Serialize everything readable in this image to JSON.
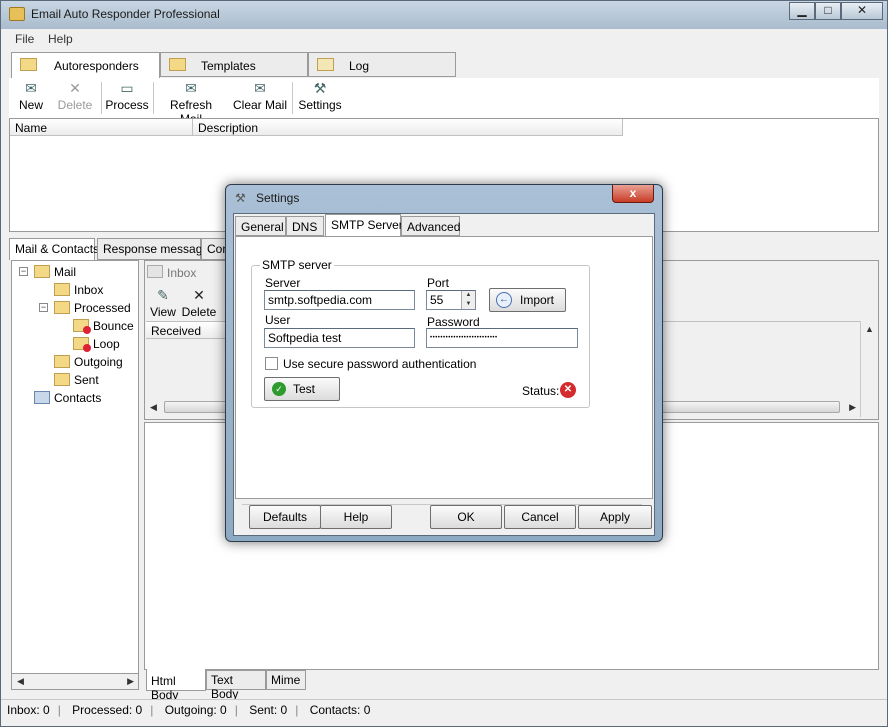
{
  "window": {
    "title": "Email Auto Responder Professional"
  },
  "menu": [
    "File",
    "Help"
  ],
  "top_tabs": [
    "Autoresponders",
    "Templates",
    "Log"
  ],
  "toolbar": {
    "new": "New",
    "delete": "Delete",
    "process": "Process",
    "refresh_mail": "Refresh Mail",
    "clear_mail": "Clear Mail",
    "settings": "Settings"
  },
  "grid": {
    "columns": [
      "Name",
      "Description"
    ]
  },
  "mid_tabs": [
    "Mail & Contacts",
    "Response message",
    "Con"
  ],
  "tree": {
    "mail": "Mail",
    "inbox": "Inbox",
    "processed": "Processed",
    "bounce": "Bounce",
    "loop": "Loop",
    "outgoing": "Outgoing",
    "sent": "Sent",
    "contacts": "Contacts"
  },
  "inbox_pane": {
    "title": "Inbox",
    "view": "View",
    "delete": "Delete",
    "received_col": "Received"
  },
  "body_tabs": [
    "Html Body",
    "Text Body",
    "Mime"
  ],
  "status": {
    "inbox": "Inbox: 0",
    "processed": "Processed: 0",
    "outgoing": "Outgoing: 0",
    "sent": "Sent: 0",
    "contacts": "Contacts: 0"
  },
  "dialog": {
    "title": "Settings",
    "close": "x",
    "tabs": [
      "General",
      "DNS",
      "SMTP Server",
      "Advanced"
    ],
    "group_label": "SMTP server",
    "server_label": "Server",
    "server_value": "smtp.softpedia.com",
    "port_label": "Port",
    "port_value": "55",
    "import_button": "Import",
    "user_label": "User",
    "user_value": "Softpedia test",
    "password_label": "Password",
    "password_value": "••••••••••••••••••••••••••",
    "secure_auth_label": "Use secure password authentication",
    "test_button": "Test",
    "status_label": "Status:",
    "buttons": {
      "defaults": "Defaults",
      "help": "Help",
      "ok": "OK",
      "cancel": "Cancel",
      "apply": "Apply"
    }
  }
}
